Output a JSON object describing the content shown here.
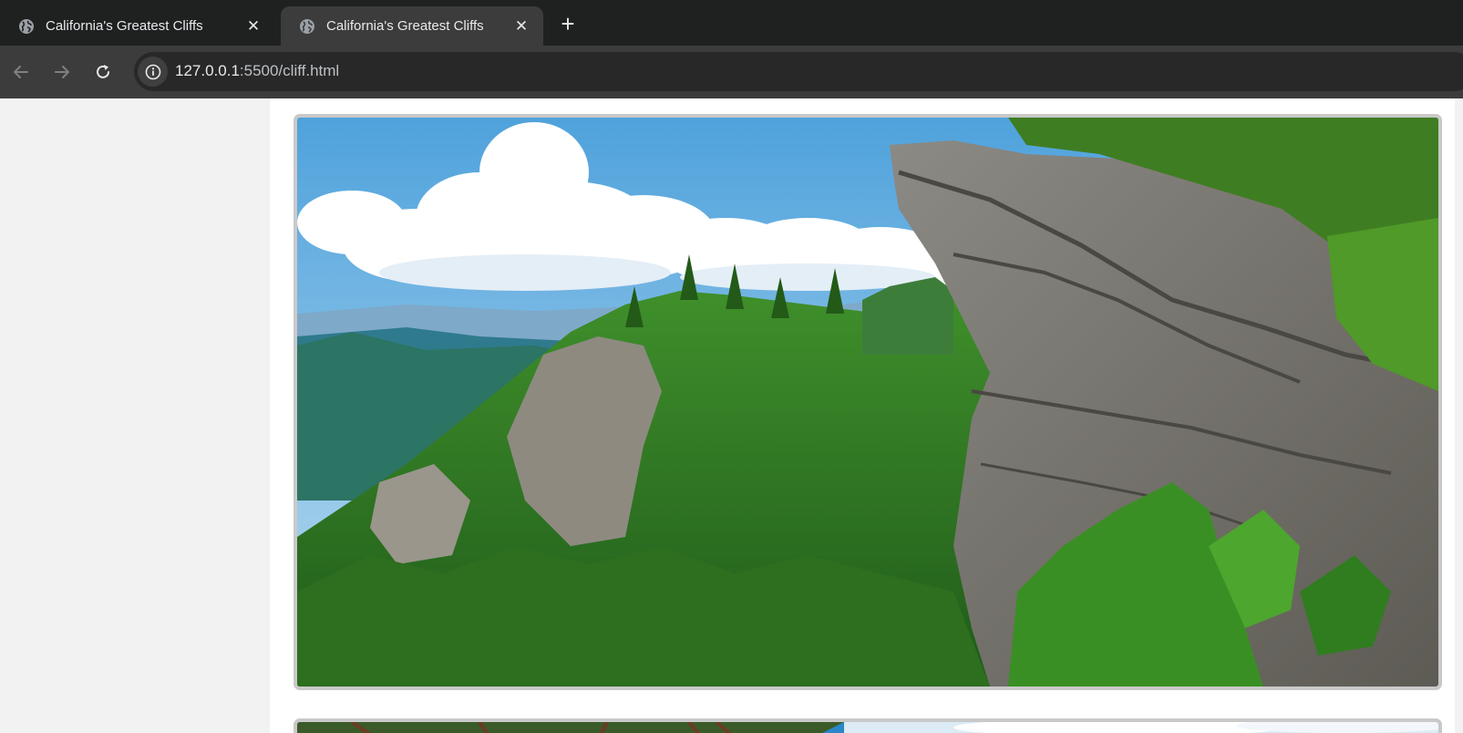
{
  "browser": {
    "tabs": [
      {
        "title": "California's Greatest Cliffs",
        "icon": "globe-icon",
        "active": false
      },
      {
        "title": "California's Greatest Cliffs",
        "icon": "globe-icon",
        "active": true
      }
    ],
    "new_tab_icon": "plus-icon",
    "close_icon": "close-icon",
    "nav": {
      "back_icon": "back-arrow-icon",
      "forward_icon": "forward-arrow-icon",
      "reload_icon": "reload-icon"
    },
    "address_bar": {
      "icon": "info-icon",
      "host": "127.0.0.1",
      "path": ":5500/cliff.html"
    }
  },
  "page": {
    "images": [
      {
        "name": "cliff-photo-1",
        "subject": "rocky cliff outcrop above forested mountain ridge under blue sky with clouds"
      },
      {
        "name": "cliff-photo-2",
        "subject": "tree branches against blue sky (partially visible)"
      }
    ]
  },
  "colors": {
    "tabbar_bg": "#1f2020",
    "toolbar_bg": "#3c3c3c",
    "page_bg": "#f2f2f2",
    "panel_bg": "#ffffff",
    "frame_border": "#c9c9c9"
  }
}
